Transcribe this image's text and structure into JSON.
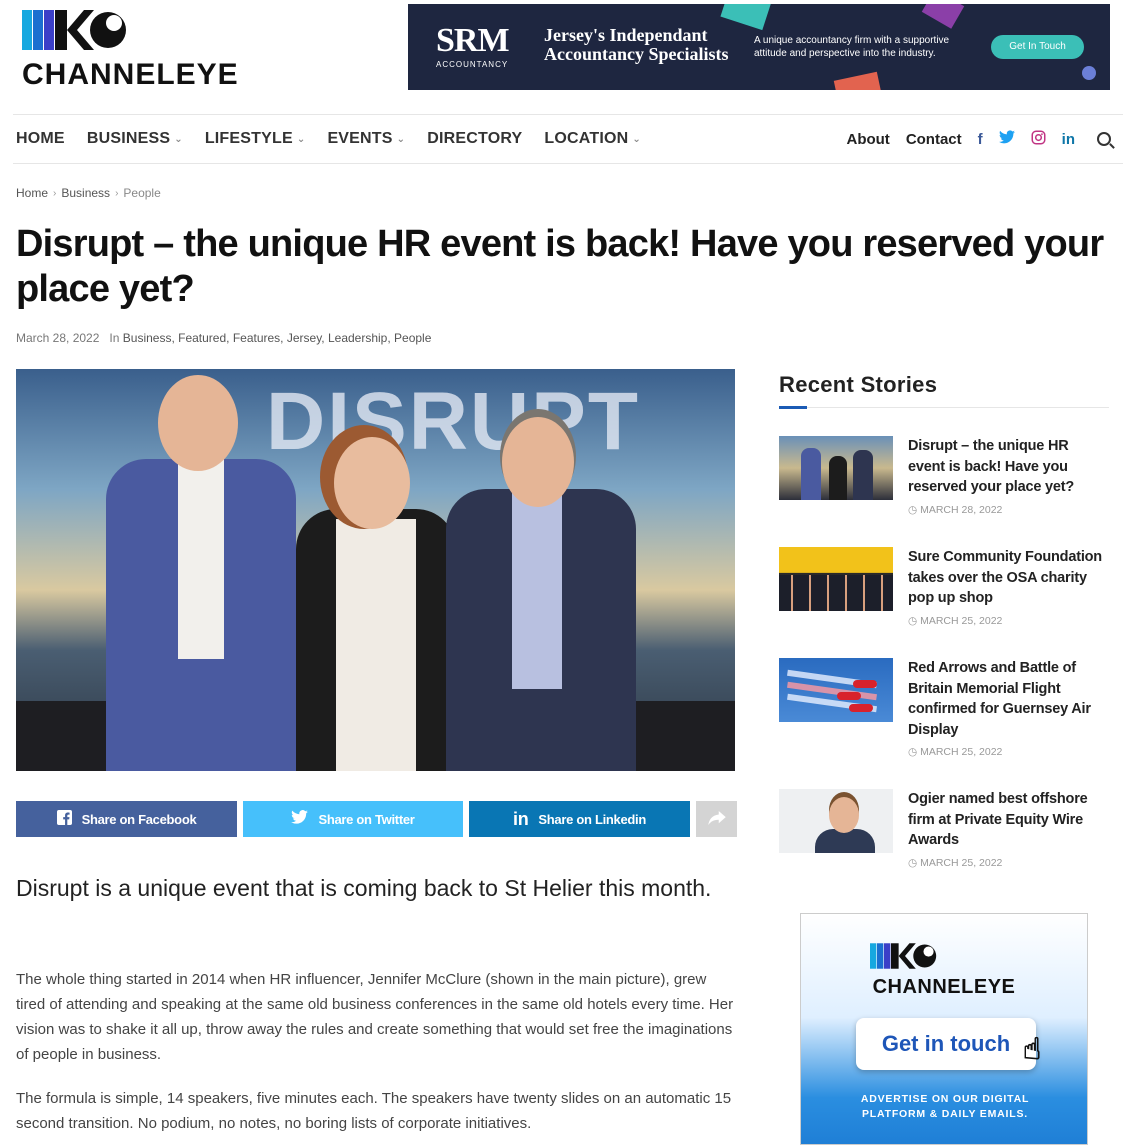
{
  "site": {
    "logo_text": "CHANNELEYE"
  },
  "ad_banner": {
    "brand": "SRM",
    "brand_sub": "ACCOUNTANCY",
    "headline": "Jersey's Independant Accountancy Specialists",
    "copy": "A unique accountancy firm with a supportive attitude and perspective into the industry.",
    "cta": "Get In Touch"
  },
  "nav": {
    "items": [
      {
        "label": "HOME",
        "dropdown": false
      },
      {
        "label": "BUSINESS",
        "dropdown": true
      },
      {
        "label": "LIFESTYLE",
        "dropdown": true
      },
      {
        "label": "EVENTS",
        "dropdown": true
      },
      {
        "label": "DIRECTORY",
        "dropdown": false
      },
      {
        "label": "LOCATION",
        "dropdown": true
      }
    ],
    "about": "About",
    "contact": "Contact",
    "social": {
      "facebook": "f",
      "twitter": "🐦",
      "instagram": "◎",
      "linkedin": "in"
    }
  },
  "breadcrumb": [
    "Home",
    "Business",
    "People"
  ],
  "article": {
    "title": "Disrupt – the unique HR event is back! Have you reserved your place yet?",
    "date": "March 28, 2022",
    "in_label": "In",
    "categories": "Business, Featured, Features, Jersey, Leadership, People",
    "hero_text": "DISRUPT",
    "lead": "Disrupt is a unique event that is coming back to St Helier this month.",
    "paragraphs": [
      "The whole thing started in 2014 when HR influencer, Jennifer McClure (shown in the main picture), grew tired of attending and speaking at the same old business conferences in the same old hotels every time. Her vision was to shake it all up, throw away the rules and create something that would set free the imaginations of people in business.",
      "The formula is simple, 14 speakers, five minutes each. The speakers have twenty slides on an automatic 15 second transition. No podium, no notes, no boring lists of corporate initiatives."
    ]
  },
  "share": {
    "facebook": "Share on Facebook",
    "twitter": "Share on Twitter",
    "linkedin": "Share on Linkedin"
  },
  "sidebar": {
    "title": "Recent Stories",
    "stories": [
      {
        "title": "Disrupt – the unique HR event is back! Have you reserved your place yet?",
        "date": "MARCH 28, 2022"
      },
      {
        "title": "Sure Community Foundation takes over the OSA charity pop up shop",
        "date": "MARCH 25, 2022"
      },
      {
        "title": "Red Arrows and Battle of Britain Memorial Flight confirmed for Guernsey Air Display",
        "date": "MARCH 25, 2022"
      },
      {
        "title": "Ogier named best offshore firm at Private Equity Wire Awards",
        "date": "MARCH 25, 2022"
      }
    ]
  },
  "side_ad": {
    "logo": "CHANNELEYE",
    "cta": "Get in touch",
    "copy": "ADVERTISE ON OUR DIGITAL PLATFORM & DAILY EMAILS."
  },
  "colors": {
    "facebook": "#45619d",
    "twitter": "#46c0fb",
    "linkedin": "#0976b4",
    "accent_blue": "#1b5bb5",
    "ad_navy": "#1e2640",
    "ad_teal": "#3bbfb7"
  }
}
